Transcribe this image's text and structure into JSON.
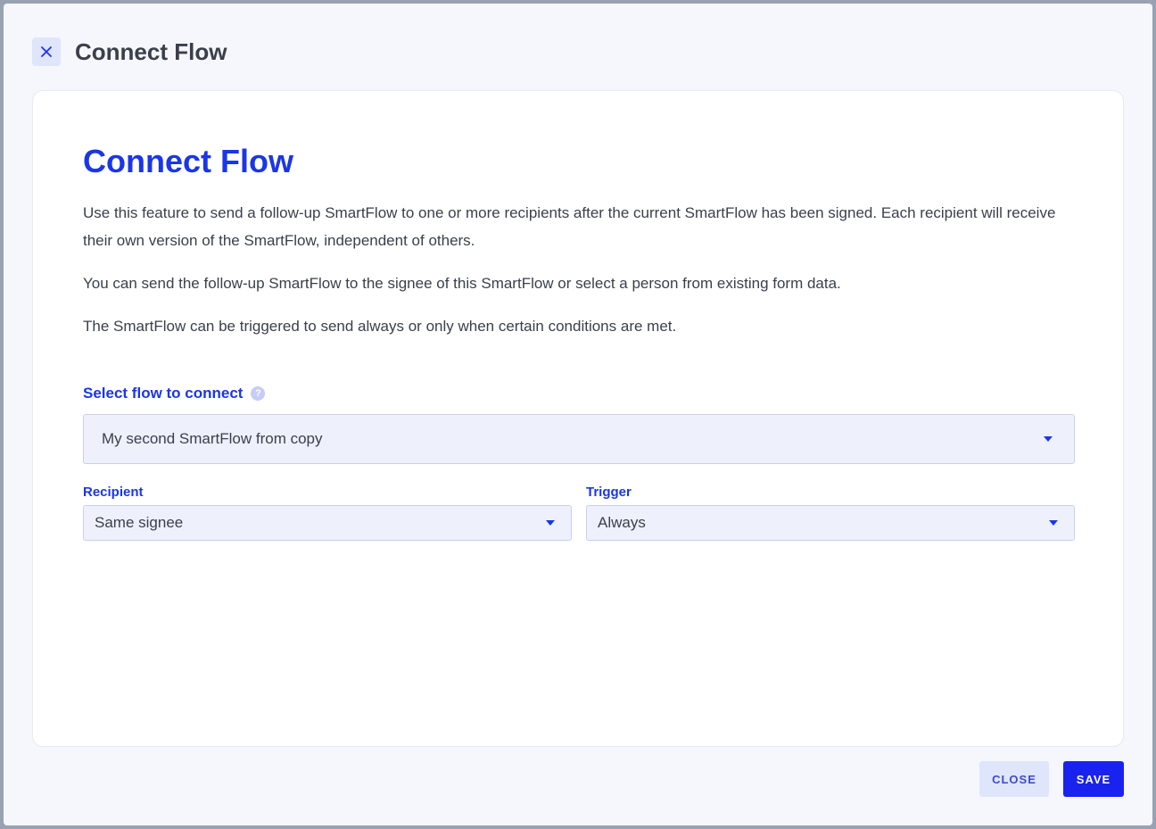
{
  "header": {
    "title": "Connect Flow",
    "close_icon": "close-icon"
  },
  "card": {
    "title": "Connect Flow",
    "descriptions": [
      "Use this feature to send a follow-up SmartFlow to one or more recipients after the current SmartFlow has been signed. Each recipient will receive their own version of the SmartFlow, independent of others.",
      "You can send the follow-up SmartFlow to the signee of this SmartFlow or select a person from existing form data.",
      "The SmartFlow can be triggered to send always or only when certain conditions are met."
    ],
    "flow_select": {
      "label": "Select flow to connect",
      "help": "?",
      "value": "My second SmartFlow from copy"
    },
    "recipient_select": {
      "label": "Recipient",
      "value": "Same signee"
    },
    "trigger_select": {
      "label": "Trigger",
      "value": "Always"
    }
  },
  "footer": {
    "close_label": "CLOSE",
    "save_label": "SAVE"
  },
  "colors": {
    "accent": "#1a36e8",
    "primary_button": "#1a22f0",
    "secondary_button": "#dfe5fb",
    "background": "#f5f7fc"
  }
}
